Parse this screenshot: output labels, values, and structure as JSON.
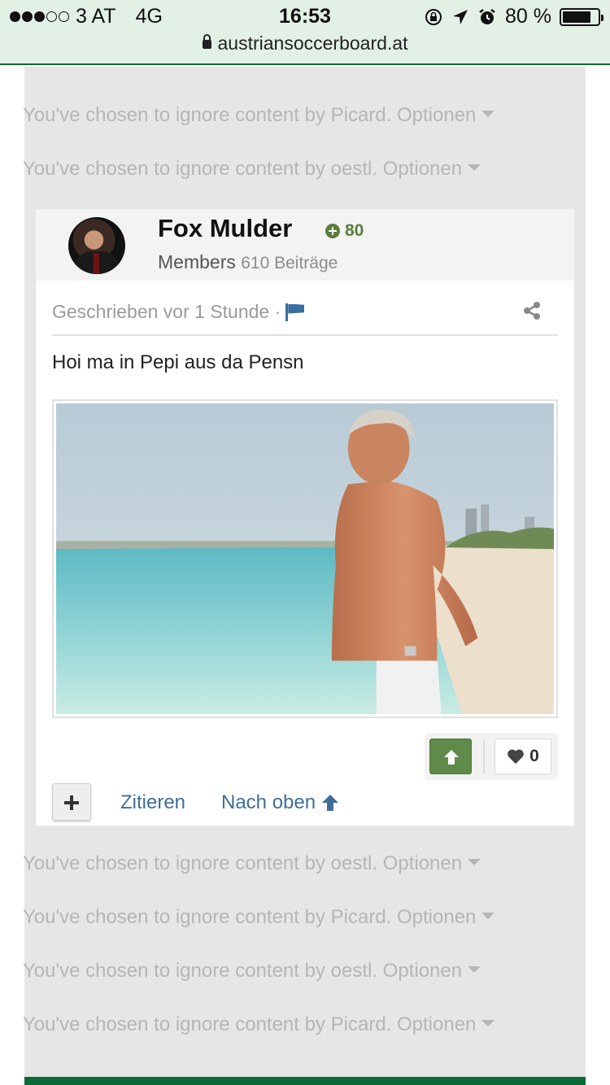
{
  "status_bar": {
    "carrier": "3 AT",
    "network": "4G",
    "time": "16:53",
    "battery": "80 %",
    "battery_level": 0.8,
    "url": "austriansoccerboard.at"
  },
  "ignored_before": [
    {
      "text": "You've chosen to ignore content by Picard.",
      "action": "Optionen"
    },
    {
      "text": "You've chosen to ignore content by oestl.",
      "action": "Optionen"
    }
  ],
  "post": {
    "author": "Fox Mulder",
    "reputation": "80",
    "group": "Members",
    "post_count": "610 Beiträge",
    "posted": "Geschrieben vor 1 Stunde ·",
    "text": "Hoi ma in Pepi aus da Pensn",
    "like_count": "0",
    "quote_label": "Zitieren",
    "top_label": "Nach oben"
  },
  "ignored_after": [
    {
      "text": "You've chosen to ignore content by oestl.",
      "action": "Optionen"
    },
    {
      "text": "You've chosen to ignore content by Picard.",
      "action": "Optionen"
    },
    {
      "text": "You've chosen to ignore content by oestl.",
      "action": "Optionen"
    },
    {
      "text": "You've chosen to ignore content by Picard.",
      "action": "Optionen"
    }
  ],
  "colors": {
    "brand_green": "#0b6b34",
    "upvote_green": "#5f8a4a",
    "link_blue": "#3f6f96",
    "ignore_gray": "#b6b6b6"
  }
}
